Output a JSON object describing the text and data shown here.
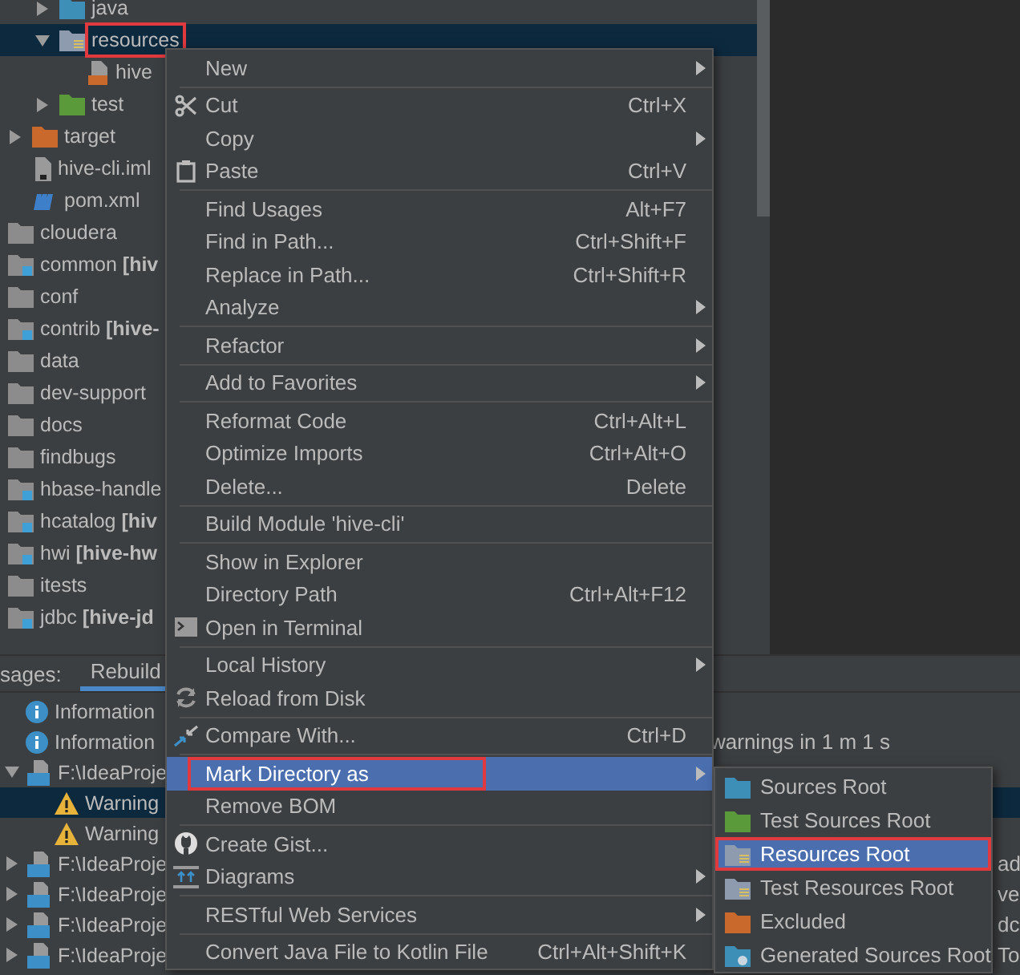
{
  "tree": [
    {
      "children": [
        {
          "children": [
            {
              "label": "java",
              "kind": "source-folder",
              "expanded": false
            },
            {
              "label": "resources",
              "kind": "resource-folder",
              "expanded": true,
              "selected": true,
              "annotated": true,
              "children": [
                {
                  "label": "hive",
                  "kind": "xml-file"
                }
              ]
            },
            {
              "label": "test",
              "kind": "test-folder",
              "expanded": false
            }
          ]
        },
        {
          "label": "target",
          "kind": "excluded-folder",
          "expanded": false
        },
        {
          "label": "hive-cli.iml",
          "kind": "iml-file"
        },
        {
          "label": "pom.xml",
          "kind": "maven-file"
        }
      ]
    },
    {
      "label": "cloudera",
      "kind": "folder"
    },
    {
      "label": "common **[hiv**",
      "kind": "module-folder"
    },
    {
      "label": "conf",
      "kind": "folder"
    },
    {
      "label": "contrib **[hive-**",
      "kind": "module-folder"
    },
    {
      "label": "data",
      "kind": "folder"
    },
    {
      "label": "dev-support",
      "kind": "folder"
    },
    {
      "label": "docs",
      "kind": "folder"
    },
    {
      "label": "findbugs",
      "kind": "folder"
    },
    {
      "label": "hbase-handle",
      "kind": "module-folder"
    },
    {
      "label": "hcatalog **[hiv**",
      "kind": "module-folder"
    },
    {
      "label": "hwi **[hive-hw**",
      "kind": "module-folder"
    },
    {
      "label": "itests",
      "kind": "folder"
    },
    {
      "label": "jdbc **[hive-jd**",
      "kind": "module-folder"
    }
  ],
  "messages_panel": {
    "title": "sages:",
    "tabs": [
      {
        "label": "Rebuild",
        "selected": true
      }
    ],
    "rows": [
      {
        "kind": "info",
        "text": "Information"
      },
      {
        "kind": "info",
        "text": "Information",
        "summary": "warnings in 1 m 1 s"
      },
      {
        "kind": "file",
        "text": "F:\\IdeaProje",
        "expanded": true,
        "children": [
          {
            "kind": "warning",
            "text": "Warning",
            "selected": true
          },
          {
            "kind": "warning",
            "text": "Warning",
            "selected": false
          }
        ]
      },
      {
        "kind": "file",
        "text": "F:\\IdeaProje",
        "expanded": false,
        "column_3": "ad"
      },
      {
        "kind": "file",
        "text": "F:\\IdeaProje",
        "expanded": false,
        "column_3": "ve"
      },
      {
        "kind": "file",
        "text": "F:\\IdeaProje",
        "expanded": false,
        "column_3": "dc"
      },
      {
        "kind": "file",
        "text": "F:\\IdeaProje",
        "expanded": false,
        "column_3": "To"
      }
    ]
  },
  "context_menu": {
    "groups": [
      [
        {
          "label": "New",
          "submenu": true
        }
      ],
      [
        {
          "label": "Cut",
          "kind": "scissors",
          "shortcut": "Ctrl+X"
        },
        {
          "label": "Copy",
          "submenu": true
        },
        {
          "label": "Paste",
          "kind": "clipboard",
          "shortcut": "Ctrl+V"
        }
      ],
      [
        {
          "label": "Find Usages",
          "shortcut": "Alt+F7"
        },
        {
          "label": "Find in Path...",
          "shortcut": "Ctrl+Shift+F"
        },
        {
          "label": "Replace in Path...",
          "shortcut": "Ctrl+Shift+R"
        },
        {
          "label": "Analyze",
          "submenu": true
        }
      ],
      [
        {
          "label": "Refactor",
          "submenu": true
        }
      ],
      [
        {
          "label": "Add to Favorites",
          "submenu": true
        }
      ],
      [
        {
          "label": "Reformat Code",
          "shortcut": "Ctrl+Alt+L"
        },
        {
          "label": "Optimize Imports",
          "shortcut": "Ctrl+Alt+O"
        },
        {
          "label": "Delete...",
          "shortcut": "Delete"
        }
      ],
      [
        {
          "label": "Build Module 'hive-cli'"
        }
      ],
      [
        {
          "label": "Show in Explorer"
        },
        {
          "label": "Directory Path",
          "shortcut": "Ctrl+Alt+F12"
        },
        {
          "label": "Open in Terminal",
          "kind": "terminal"
        }
      ],
      [
        {
          "label": "Local History",
          "submenu": true
        },
        {
          "label": "Reload from Disk",
          "kind": "refresh"
        }
      ],
      [
        {
          "label": "Compare With...",
          "kind": "compare",
          "shortcut": "Ctrl+D"
        }
      ],
      [
        {
          "label": "Mark Directory as",
          "submenu": true,
          "selected": true,
          "annotated": true
        },
        {
          "label": "Remove BOM"
        }
      ],
      [
        {
          "label": "Create Gist...",
          "kind": "octocat"
        },
        {
          "label": "Diagrams",
          "kind": "diagram",
          "submenu": true
        }
      ],
      [
        {
          "label": "RESTful Web Services",
          "submenu": true
        }
      ],
      [
        {
          "label": "Convert Java File to Kotlin File",
          "shortcut": "Ctrl+Alt+Shift+K"
        }
      ]
    ]
  },
  "submenu": {
    "items": [
      {
        "label": "Sources Root",
        "kind": "source-folder",
        "selected": false
      },
      {
        "label": "Test Sources Root",
        "kind": "test-folder",
        "selected": false
      },
      {
        "label": "Resources Root",
        "kind": "resource-folder",
        "selected": true,
        "annotated": true
      },
      {
        "label": "Test Resources Root",
        "kind": "test-resource-folder",
        "selected": false
      },
      {
        "label": "Excluded",
        "kind": "excluded-folder",
        "selected": false
      },
      {
        "label": "Generated Sources Root",
        "kind": "generated-folder",
        "selected": false
      }
    ]
  }
}
